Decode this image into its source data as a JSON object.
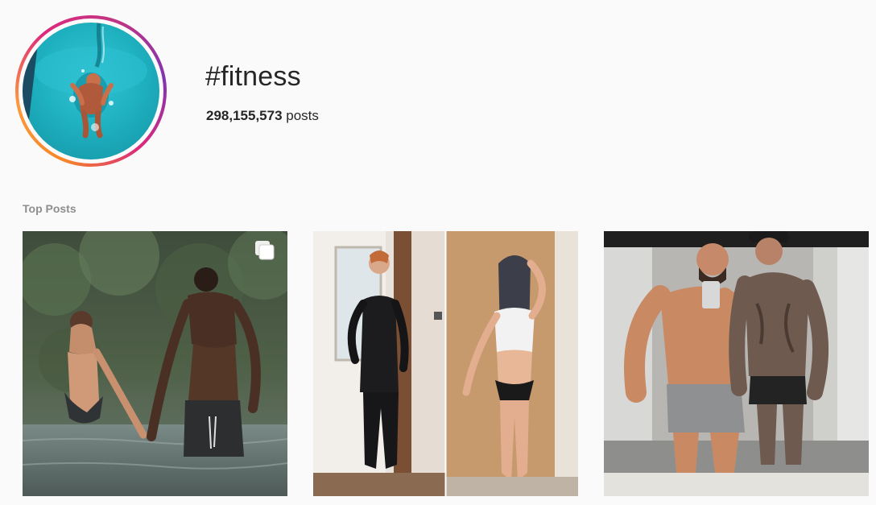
{
  "header": {
    "hashtag": "#fitness",
    "post_count": "298,155,573",
    "post_count_suffix": " posts",
    "avatar_icon": "swimmer-avatar"
  },
  "top_posts": {
    "title": "Top Posts",
    "tiles": [
      {
        "icon": "multiple-photos-icon",
        "subject": "couple-in-river"
      },
      {
        "icon": "",
        "subject": "before-after-transformation"
      },
      {
        "icon": "",
        "subject": "gym-mirror-selfie"
      }
    ]
  },
  "colors": {
    "background": "#fafafa",
    "text": "#262626",
    "muted": "#8e8e8e",
    "ring_start": "#f58529",
    "ring_end": "#dd2a7b"
  }
}
